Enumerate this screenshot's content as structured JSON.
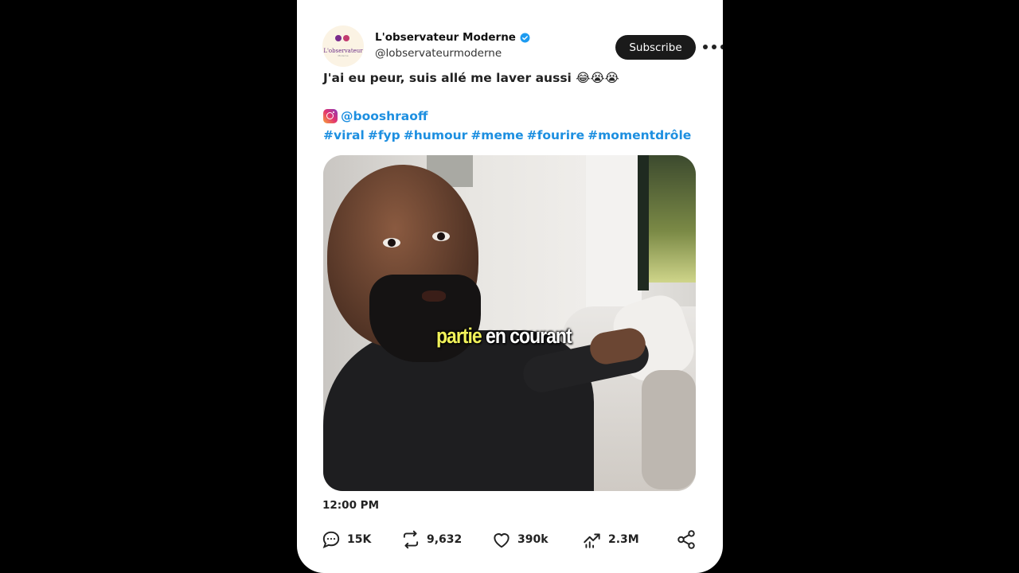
{
  "account": {
    "display_name": "L'observateur Moderne",
    "handle": "@lobservateurmoderne",
    "verified": true,
    "avatar_logo_text": "L'observateur",
    "avatar_logo_sub": "Moderne"
  },
  "subscribe_label": "Subscribe",
  "post": {
    "text": "J'ai eu peur, suis allé me laver aussi 😂😭😭",
    "mention": "@booshraoff",
    "hashtags": [
      "#viral",
      "#fyp",
      "#humour",
      "#meme",
      "#fourire",
      "#momentdrôle"
    ],
    "caption_highlight": "partie",
    "caption_rest": " en courant",
    "timestamp": "12:00 PM"
  },
  "stats": {
    "replies": "15K",
    "reposts": "9,632",
    "likes": "390k",
    "views": "2.3M"
  },
  "colors": {
    "link": "#1d8fe0",
    "verified": "#1d9bf0",
    "caption_highlight": "#f1f25a",
    "button_bg": "#1a1a1a"
  }
}
